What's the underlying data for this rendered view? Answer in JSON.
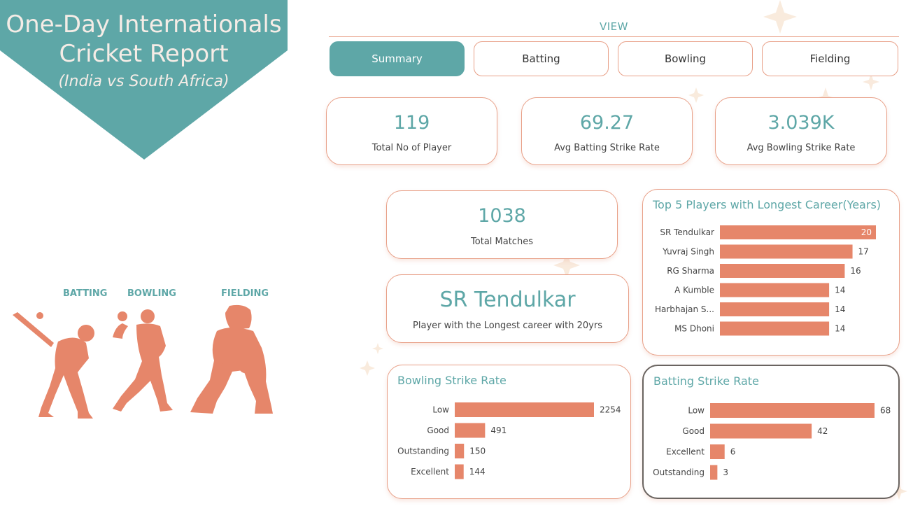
{
  "header": {
    "title_line1": "One-Day Internationals",
    "title_line2": "Cricket Report",
    "subtitle": "(India vs South Africa)"
  },
  "view": {
    "label": "VIEW",
    "tabs": [
      {
        "label": "Summary",
        "active": true
      },
      {
        "label": "Batting",
        "active": false
      },
      {
        "label": "Bowling",
        "active": false
      },
      {
        "label": "Fielding",
        "active": false
      }
    ]
  },
  "kpis": {
    "total_players": {
      "value": "119",
      "label": "Total No of Player"
    },
    "avg_batting_sr": {
      "value": "69.27",
      "label": "Avg Batting Strike Rate"
    },
    "avg_bowling_sr": {
      "value": "3.039K",
      "label": "Avg Bowling Strike Rate"
    },
    "total_matches": {
      "value": "1038",
      "label": "Total Matches"
    },
    "longest_career": {
      "value": "SR Tendulkar",
      "label": "Player with the Longest career with 20yrs"
    }
  },
  "silhouettes": {
    "batting": "BATTING",
    "bowling": "BOWLING",
    "fielding": "FIELDING"
  },
  "colors": {
    "teal": "#5ea7a7",
    "bar": "#e6866a",
    "border": "#e8a088"
  },
  "chart_data": [
    {
      "type": "bar",
      "orientation": "horizontal",
      "title": "Top 5 Players with Longest Career(Years)",
      "categories": [
        "SR Tendulkar",
        "Yuvraj Singh",
        "RG Sharma",
        "A Kumble",
        "Harbhajan S...",
        "MS Dhoni"
      ],
      "values": [
        20,
        17,
        16,
        14,
        14,
        14
      ],
      "xlim": [
        0,
        20
      ]
    },
    {
      "type": "bar",
      "orientation": "horizontal",
      "title": "Bowling Strike Rate",
      "categories": [
        "Low",
        "Good",
        "Outstanding",
        "Excellent"
      ],
      "values": [
        2254,
        491,
        150,
        144
      ],
      "xlim": [
        0,
        2254
      ]
    },
    {
      "type": "bar",
      "orientation": "horizontal",
      "title": "Batting Strike Rate",
      "categories": [
        "Low",
        "Good",
        "Excellent",
        "Outstanding"
      ],
      "values": [
        68,
        42,
        6,
        3
      ],
      "xlim": [
        0,
        68
      ]
    }
  ]
}
